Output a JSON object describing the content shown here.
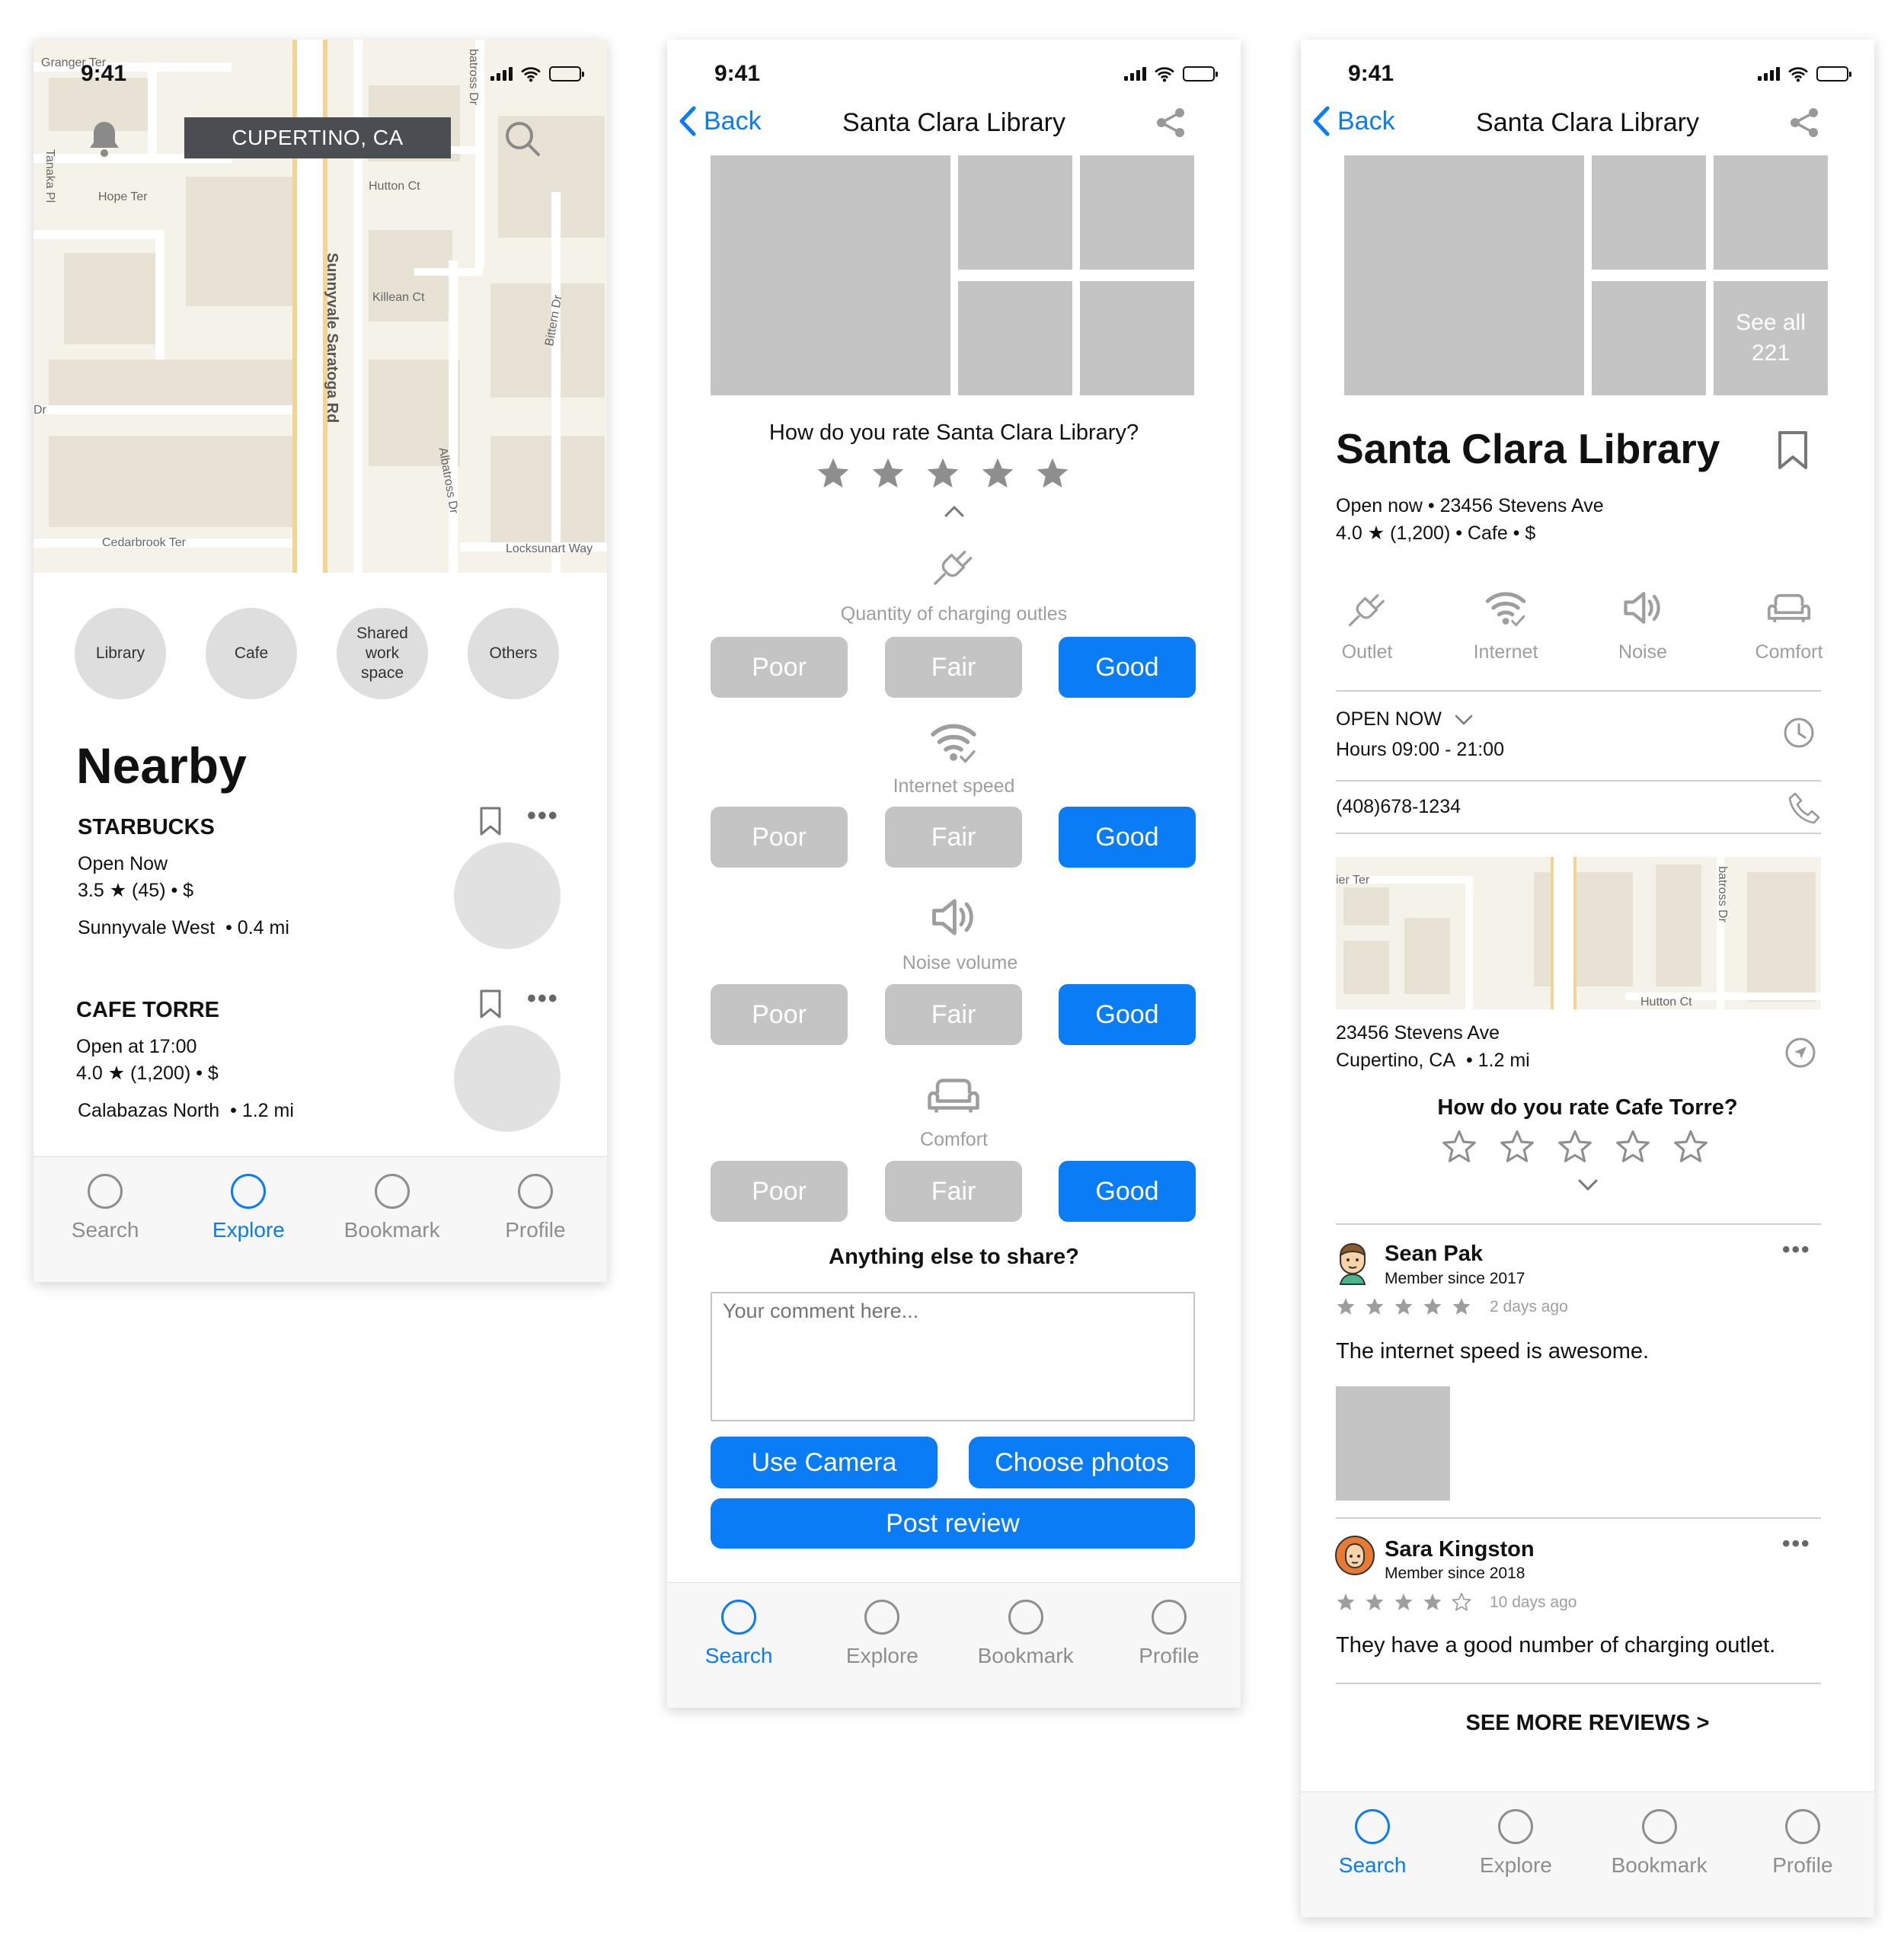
{
  "phone1": {
    "time": "9:41",
    "location": "CUPERTINO, CA",
    "map_streets": [
      "Granger Ter",
      "Tanaka Pl",
      "Hope Ter",
      "Hutton Ct",
      "Killean Ct",
      "Sunnyvale Saratoga Rd",
      "batross Dr",
      "Bittern Dr",
      "Albatross Dr",
      "Cedarbrook Ter",
      "Locksunart Way",
      "Dr"
    ],
    "categories": [
      "Library",
      "Cafe",
      "Shared work space",
      "Others"
    ],
    "section_title": "Nearby",
    "places": [
      {
        "name": "STARBUCKS",
        "status": "Open Now",
        "rating": "3.5 ★ (45) • $",
        "area": "Sunnyvale West",
        "distance": "• 0.4 mi"
      },
      {
        "name": "CAFE TORRE",
        "status": "Open at 17:00",
        "rating": "4.0 ★ (1,200) • $",
        "area": "Calabazas North",
        "distance": "• 1.2 mi"
      }
    ],
    "tabs": [
      {
        "label": "Search"
      },
      {
        "label": "Explore"
      },
      {
        "label": "Bookmark"
      },
      {
        "label": "Profile"
      }
    ]
  },
  "phone2": {
    "time": "9:41",
    "back": "Back",
    "title": "Santa Clara Library",
    "question": "How do you rate Santa Clara Library?",
    "rating_value": 5,
    "criteria": [
      {
        "icon": "plug-icon",
        "label": "Quantity of charging outles",
        "selected": "Good"
      },
      {
        "icon": "wifi-icon",
        "label": "Internet speed",
        "selected": "Good"
      },
      {
        "icon": "speaker-icon",
        "label": "Noise volume",
        "selected": "Good"
      },
      {
        "icon": "sofa-icon",
        "label": "Comfort",
        "selected": "Good"
      }
    ],
    "options": {
      "poor": "Poor",
      "fair": "Fair",
      "good": "Good"
    },
    "share_question": "Anything else to share?",
    "comment_placeholder": "Your comment here...",
    "use_camera": "Use Camera",
    "choose_photos": "Choose photos",
    "post_review": "Post review",
    "tabs": [
      {
        "label": "Search"
      },
      {
        "label": "Explore"
      },
      {
        "label": "Bookmark"
      },
      {
        "label": "Profile"
      }
    ]
  },
  "phone3": {
    "time": "9:41",
    "back": "Back",
    "title": "Santa Clara Library",
    "see_all": "See all",
    "see_all_count": "221",
    "name": "Santa Clara Library",
    "line1": "Open now • 23456 Stevens Ave",
    "line2": "4.0 ★ (1,200) • Cafe • $",
    "amenities": [
      {
        "icon": "plug-icon",
        "label": "Outlet"
      },
      {
        "icon": "wifi-icon",
        "label": "Internet"
      },
      {
        "icon": "speaker-icon",
        "label": "Noise"
      },
      {
        "icon": "sofa-icon",
        "label": "Comfort"
      }
    ],
    "open_now": "OPEN NOW",
    "hours": "Hours 09:00 - 21:00",
    "phone": "(408)678-1234",
    "map_streets": [
      "ier Ter",
      "batross Dr",
      "Hutton Ct"
    ],
    "address1": "23456 Stevens Ave",
    "address2": "Cupertino, CA",
    "distance": "• 1.2 mi",
    "rate_question": "How do you rate Cafe Torre?",
    "reviews": [
      {
        "name": "Sean Pak",
        "member": "Member since 2017",
        "stars": 5,
        "ago": "2 days ago",
        "text": "The internet speed is awesome."
      },
      {
        "name": "Sara Kingston",
        "member": "Member since 2018",
        "stars": 4,
        "ago": "10 days ago",
        "text": "They have a good number of charging outlet."
      }
    ],
    "see_more": "SEE MORE REVIEWS >",
    "tabs": [
      {
        "label": "Search"
      },
      {
        "label": "Explore"
      },
      {
        "label": "Bookmark"
      },
      {
        "label": "Profile"
      }
    ]
  },
  "colors": {
    "accent": "#0a7cf5",
    "placeholder_gray": "#c4c4c4",
    "icon_gray": "#9e9e9e"
  }
}
